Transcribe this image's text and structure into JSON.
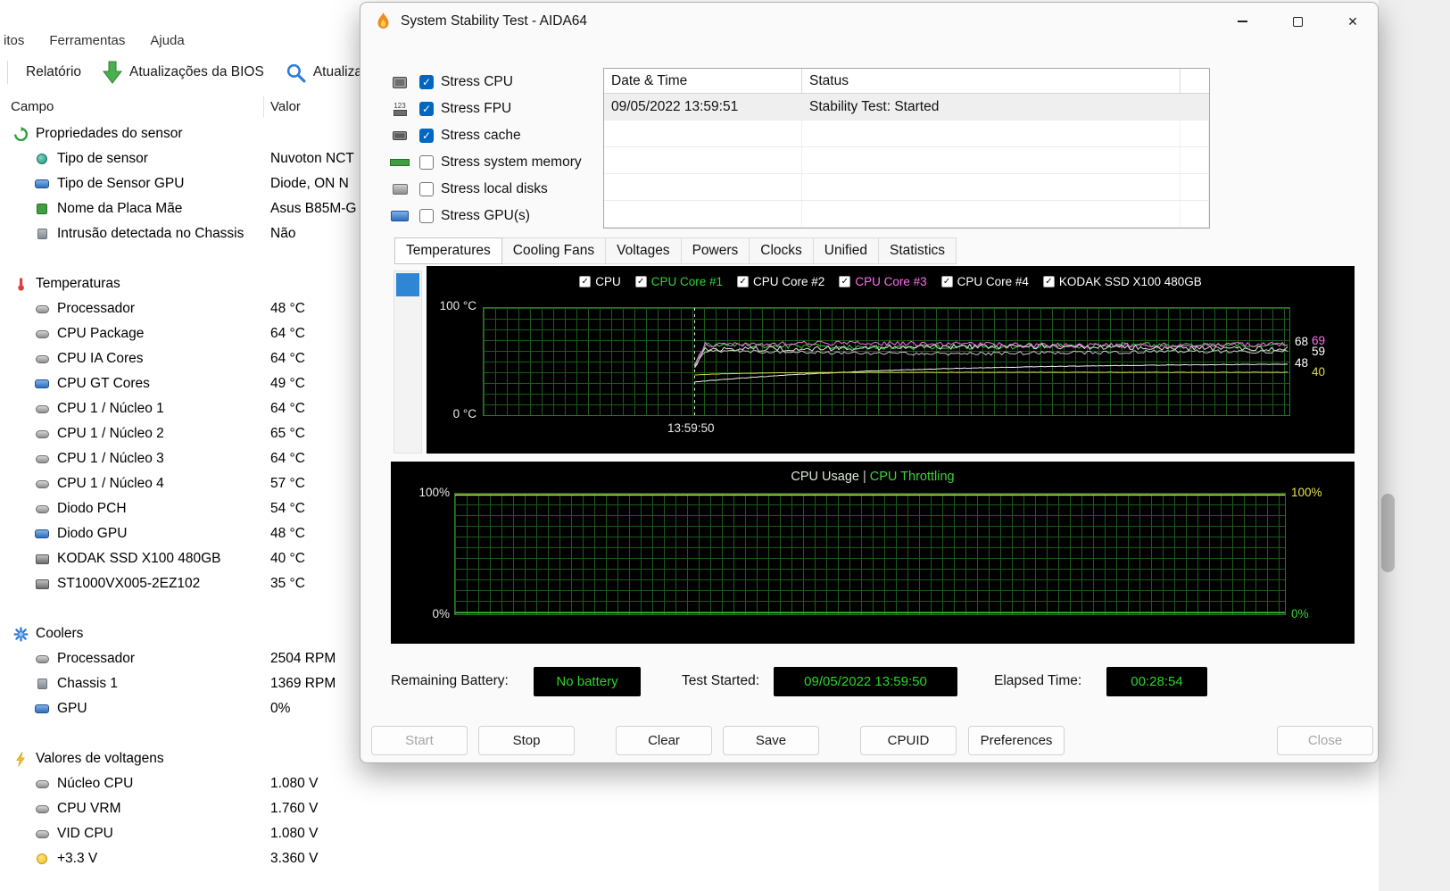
{
  "background_window": {
    "menu_items": [
      "itos",
      "Ferramentas",
      "Ajuda"
    ],
    "toolbar": {
      "report_label": "Relatório",
      "bios_updates_label": "Atualizações da BIOS",
      "update_label": "Atualiza"
    },
    "table": {
      "columns": {
        "field": "Campo",
        "value": "Valor"
      },
      "sections": [
        {
          "title": "Propriedades do sensor",
          "icon": "sensor-props",
          "rows": [
            {
              "icon": "probe",
              "label": "Tipo de sensor",
              "value": "Nuvoton NCT"
            },
            {
              "icon": "gpu",
              "label": "Tipo de Sensor GPU",
              "value": "Diode, ON N"
            },
            {
              "icon": "board",
              "label": "Nome da Placa Mãe",
              "value": "Asus B85M-G"
            },
            {
              "icon": "case",
              "label": "Intrusão detectada no Chassis",
              "value": "Não"
            }
          ]
        },
        {
          "title": "Temperaturas",
          "icon": "thermo",
          "rows": [
            {
              "icon": "temp",
              "label": "Processador",
              "value": "48 °C"
            },
            {
              "icon": "temp",
              "label": "CPU Package",
              "value": "64 °C"
            },
            {
              "icon": "temp",
              "label": "CPU IA Cores",
              "value": "64 °C"
            },
            {
              "icon": "gpu",
              "label": "CPU GT Cores",
              "value": "49 °C"
            },
            {
              "icon": "temp",
              "label": "CPU 1 / Núcleo 1",
              "value": "64 °C"
            },
            {
              "icon": "temp",
              "label": "CPU 1 / Núcleo 2",
              "value": "65 °C"
            },
            {
              "icon": "temp",
              "label": "CPU 1 / Núcleo 3",
              "value": "64 °C"
            },
            {
              "icon": "temp",
              "label": "CPU 1 / Núcleo 4",
              "value": "57 °C"
            },
            {
              "icon": "temp",
              "label": "Diodo PCH",
              "value": "54 °C"
            },
            {
              "icon": "gpu",
              "label": "Diodo GPU",
              "value": "48 °C"
            },
            {
              "icon": "disk",
              "label": "KODAK SSD X100 480GB",
              "value": "40 °C"
            },
            {
              "icon": "disk",
              "label": "ST1000VX005-2EZ102",
              "value": "35 °C"
            }
          ]
        },
        {
          "title": "Coolers",
          "icon": "fan",
          "rows": [
            {
              "icon": "temp",
              "label": "Processador",
              "value": "2504 RPM"
            },
            {
              "icon": "case",
              "label": "Chassis 1",
              "value": "1369 RPM"
            },
            {
              "icon": "gpu",
              "label": "GPU",
              "value": "0%"
            }
          ]
        },
        {
          "title": "Valores de voltagens",
          "icon": "bolt",
          "rows": [
            {
              "icon": "temp",
              "label": "Núcleo CPU",
              "value": "1.080 V"
            },
            {
              "icon": "temp",
              "label": "CPU VRM",
              "value": "1.760 V"
            },
            {
              "icon": "temp",
              "label": "VID CPU",
              "value": "1.080 V"
            },
            {
              "icon": "bolt",
              "label": "+3.3 V",
              "value": "3.360 V"
            }
          ]
        }
      ]
    }
  },
  "dialog": {
    "title": "System Stability Test - AIDA64",
    "stress_options": [
      {
        "label": "Stress CPU",
        "checked": true,
        "icon": "cpu"
      },
      {
        "label": "Stress FPU",
        "checked": true,
        "icon": "fpu"
      },
      {
        "label": "Stress cache",
        "checked": true,
        "icon": "cache"
      },
      {
        "label": "Stress system memory",
        "checked": false,
        "icon": "memory"
      },
      {
        "label": "Stress local disks",
        "checked": false,
        "icon": "disk"
      },
      {
        "label": "Stress GPU(s)",
        "checked": false,
        "icon": "gpu"
      }
    ],
    "log_table": {
      "columns": [
        "Date & Time",
        "Status"
      ],
      "rows": [
        {
          "datetime": "09/05/2022 13:59:51",
          "status": "Stability Test: Started"
        }
      ],
      "empty_row_count": 4
    },
    "tabs": [
      "Temperatures",
      "Cooling Fans",
      "Voltages",
      "Powers",
      "Clocks",
      "Unified",
      "Statistics"
    ],
    "active_tab_index": 0,
    "status_bar": {
      "remaining_battery_label": "Remaining Battery:",
      "remaining_battery_value": "No battery",
      "test_started_label": "Test Started:",
      "test_started_value": "09/05/2022 13:59:50",
      "elapsed_time_label": "Elapsed Time:",
      "elapsed_time_value": "00:28:54"
    },
    "buttons": [
      {
        "label": "Start",
        "enabled": false
      },
      {
        "label": "Stop",
        "enabled": true
      },
      {
        "label": "Clear",
        "enabled": true
      },
      {
        "label": "Save",
        "enabled": true
      },
      {
        "label": "CPUID",
        "enabled": true
      },
      {
        "label": "Preferences",
        "enabled": true
      },
      {
        "label": "Close",
        "enabled": false
      }
    ],
    "status_value_color": "#2dd42d"
  },
  "chart_data": [
    {
      "type": "line",
      "title": "Temperatures",
      "ylim": [
        0,
        100
      ],
      "ylabel_top": "100 °C",
      "ylabel_bottom": "0 °C",
      "x_start_label": "13:59:50",
      "test_start_fraction": 0.262,
      "grid": true,
      "legend_position": "top",
      "legend": [
        {
          "name": "CPU",
          "color": "#ffffff",
          "checked": true
        },
        {
          "name": "CPU Core #1",
          "color": "#35d435",
          "checked": true
        },
        {
          "name": "CPU Core #2",
          "color": "#ffffff",
          "checked": true
        },
        {
          "name": "CPU Core #3",
          "color": "#ff6df2",
          "checked": true
        },
        {
          "name": "CPU Core #4",
          "color": "#ffffff",
          "checked": true
        },
        {
          "name": "KODAK SSD X100 480GB",
          "color": "#ffffff",
          "checked": true
        }
      ],
      "series": [
        {
          "name": "CPU",
          "color": "#f2f2f2",
          "start": 31,
          "steady": 48.5,
          "noise": 0.25,
          "smooth": true,
          "tau": 230,
          "current": 48
        },
        {
          "name": "CPU Core #1",
          "color": "#35d435",
          "start": 46,
          "steady": 64.5,
          "noise": 2.3,
          "current": 68
        },
        {
          "name": "CPU Core #2",
          "color": "#e6e6e6",
          "start": 45,
          "steady": 63,
          "noise": 2.3
        },
        {
          "name": "CPU Core #3",
          "color": "#ff6df2",
          "start": 47,
          "steady": 66,
          "noise": 2.2,
          "current": 69
        },
        {
          "name": "CPU Core #4",
          "color": "#c8c8c8",
          "start": 44,
          "steady": 58.5,
          "noise": 1.6,
          "current": 59
        },
        {
          "name": "KODAK SSD X100 480GB",
          "color": "#d8d855",
          "start": 37.5,
          "steady": 40,
          "noise": 0.15,
          "smooth": true,
          "tau": 60,
          "current": 40
        }
      ],
      "right_labels": [
        {
          "value": "68",
          "color": "#ffffff"
        },
        {
          "value": "69",
          "color": "#ff6df2"
        },
        {
          "value": "59",
          "color": "#ffffff"
        },
        {
          "value": "48",
          "color": "#ffffff"
        },
        {
          "value": "40",
          "color": "#d8d855"
        }
      ]
    },
    {
      "type": "line",
      "title_parts": [
        "CPU Usage",
        "CPU Throttling"
      ],
      "title_colors": [
        "#d9ead2",
        "#3bd43b"
      ],
      "ylim": [
        0,
        100
      ],
      "left_labels": [
        "100%",
        "0%"
      ],
      "right_labels": [
        {
          "value": "100%",
          "color": "#e4e44c"
        },
        {
          "value": "0%",
          "color": "#35d435"
        }
      ],
      "series": [
        {
          "name": "CPU Usage",
          "color": "#e8e84a",
          "value": 100
        },
        {
          "name": "CPU Throttling",
          "color": "#35d435",
          "value": 0
        }
      ]
    }
  ]
}
